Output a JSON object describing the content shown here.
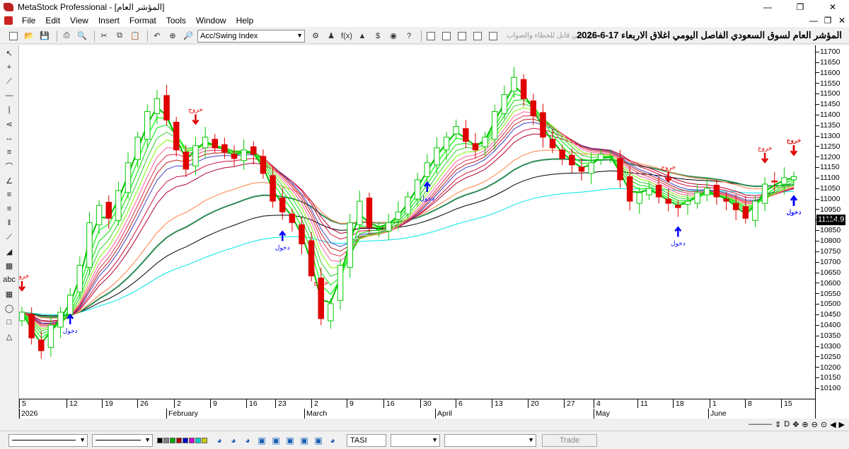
{
  "window": {
    "title": "MetaStock Professional - [المؤشر العام]",
    "minimize_icon": "minimize-icon",
    "maximize_icon": "restore-icon",
    "close_icon": "close-icon"
  },
  "menu": [
    "File",
    "Edit",
    "View",
    "Insert",
    "Format",
    "Tools",
    "Window",
    "Help"
  ],
  "toolbar": {
    "security_combo": "Acc/Swing Index",
    "hint_text": "تحليل فني قابل للخطاء والصواب",
    "chart_title": "المؤشر العام لسوق السعودي الفاصل اليومي اغلاق الاربعاء 17-6-2026"
  },
  "y_axis": {
    "ticks": [
      "11700",
      "11650",
      "11600",
      "11550",
      "11500",
      "11450",
      "11400",
      "11350",
      "11300",
      "11250",
      "11200",
      "11150",
      "11100",
      "11050",
      "11000",
      "10950",
      "10900",
      "10850",
      "10800",
      "10750",
      "10700",
      "10650",
      "10600",
      "10550",
      "10500",
      "10450",
      "10400",
      "10350",
      "10300",
      "10250",
      "10200",
      "10150",
      "10100"
    ],
    "last_price": "11114.9"
  },
  "x_axis": {
    "days": [
      {
        "label": "5",
        "x": 0
      },
      {
        "label": "12",
        "x": 67
      },
      {
        "label": "19",
        "x": 117
      },
      {
        "label": "26",
        "x": 167
      },
      {
        "label": "2",
        "x": 219
      },
      {
        "label": "9",
        "x": 270
      },
      {
        "label": "16",
        "x": 321
      },
      {
        "label": "23",
        "x": 362
      },
      {
        "label": "2",
        "x": 413
      },
      {
        "label": "9",
        "x": 463
      },
      {
        "label": "16",
        "x": 515
      },
      {
        "label": "30",
        "x": 567
      },
      {
        "label": "6",
        "x": 617
      },
      {
        "label": "13",
        "x": 668
      },
      {
        "label": "20",
        "x": 719
      },
      {
        "label": "27",
        "x": 770
      },
      {
        "label": "4",
        "x": 812
      },
      {
        "label": "11",
        "x": 874
      },
      {
        "label": "18",
        "x": 924
      },
      {
        "label": "1",
        "x": 976
      },
      {
        "label": "8",
        "x": 1026
      },
      {
        "label": "15",
        "x": 1077
      }
    ],
    "months": [
      {
        "label": "2026",
        "x": 0
      },
      {
        "label": "February",
        "x": 208
      },
      {
        "label": "March",
        "x": 403
      },
      {
        "label": "April",
        "x": 588
      },
      {
        "label": "May",
        "x": 812
      },
      {
        "label": "June",
        "x": 974
      }
    ]
  },
  "signals": {
    "exit_label": "خروج",
    "entry_label": "دخول"
  },
  "bottom": {
    "symbol": "TASI",
    "trade_label": "Trade"
  },
  "chart_data": {
    "type": "candlestick",
    "ylim": [
      10075,
      11730
    ],
    "colors": {
      "up": "#00cc00",
      "down": "#e00000",
      "entry_arrow": "#0000ff",
      "exit_arrow": "#e00000"
    },
    "closes_approx": [
      10480,
      10360,
      10300,
      10420,
      10480,
      10560,
      10700,
      10900,
      10980,
      10920,
      11050,
      11180,
      11300,
      11420,
      11480,
      11380,
      11240,
      11150,
      11260,
      11300,
      11250,
      11230,
      11200,
      11240,
      11220,
      11130,
      11000,
      10950,
      10900,
      10800,
      10650,
      10450,
      10520,
      10700,
      10900,
      11000,
      10880,
      10870,
      10900,
      10950,
      11020,
      11100,
      11180,
      11250,
      11300,
      11350,
      11280,
      11240,
      11300,
      11420,
      11500,
      11580,
      11480,
      11400,
      11300,
      11250,
      11200,
      11170,
      11140,
      11180,
      11220,
      11210,
      11100,
      11000,
      11040,
      11060,
      11020,
      10990,
      10970,
      11000,
      11040,
      11060,
      11020,
      11000,
      10960,
      10920,
      11000,
      11080,
      11090,
      11110,
      11115
    ],
    "exit_signals": [
      "2026-01-05",
      "2026-01-30",
      "2026-02-18",
      "2026-04-09",
      "2026-04-23",
      "2026-05-05",
      "2026-05-11",
      "2026-06-02"
    ],
    "entry_signals": [
      "2026-01-12",
      "2026-02-12",
      "2026-03-05",
      "2026-04-10",
      "2026-04-28",
      "2026-05-12",
      "2026-05-22",
      "2026-06-09"
    ]
  }
}
